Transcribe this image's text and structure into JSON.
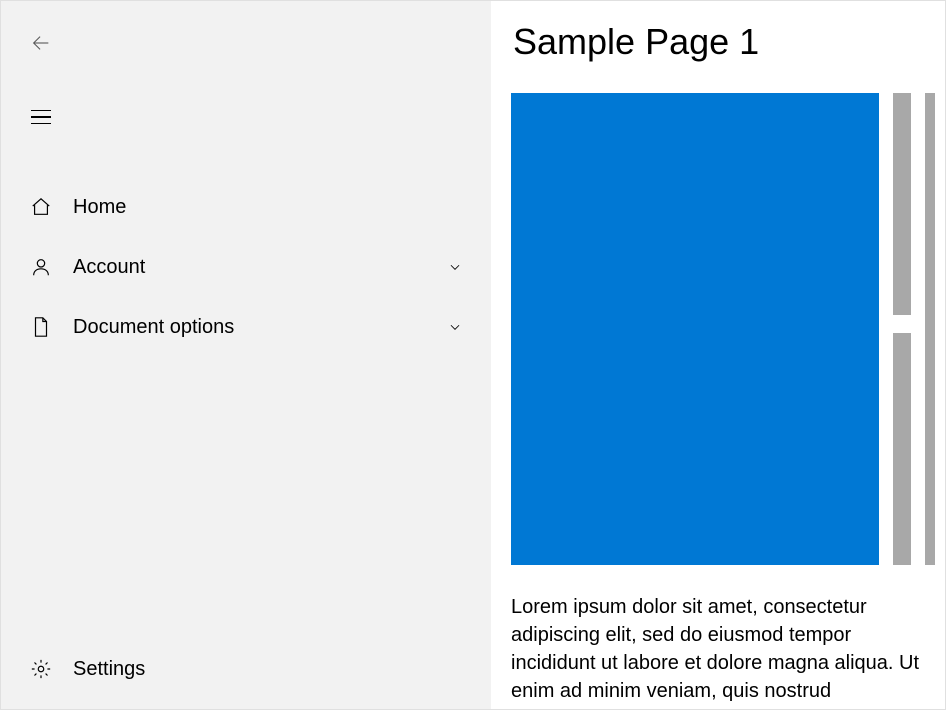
{
  "sidebar": {
    "items": [
      {
        "icon": "home-icon",
        "label": "Home",
        "hasChevron": false
      },
      {
        "icon": "person-icon",
        "label": "Account",
        "hasChevron": true
      },
      {
        "icon": "document-icon",
        "label": "Document options",
        "hasChevron": true
      }
    ],
    "footer": {
      "label": "Settings"
    }
  },
  "content": {
    "title": "Sample Page 1",
    "body": "Lorem ipsum dolor sit amet, consectetur adipiscing elit, sed do eiusmod tempor incididunt ut labore et dolore magna aliqua. Ut enim ad minim veniam, quis nostrud",
    "card_color": "#0078d4"
  }
}
